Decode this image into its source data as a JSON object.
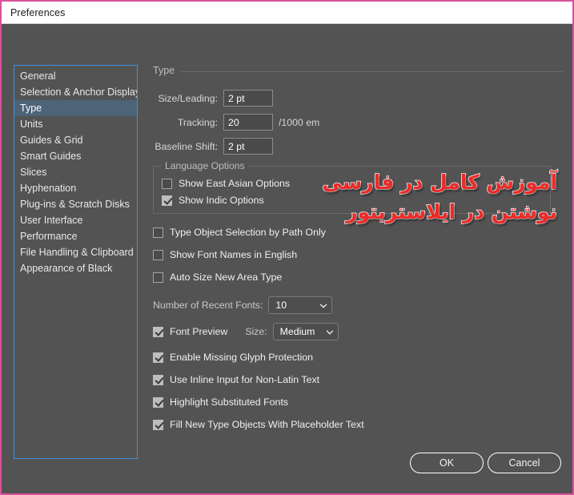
{
  "window": {
    "title": "Preferences",
    "accent_border": "#d9529c",
    "background": "#535353"
  },
  "sidebar": {
    "selected": "Type",
    "items": [
      {
        "label": "General"
      },
      {
        "label": "Selection & Anchor Display"
      },
      {
        "label": "Type"
      },
      {
        "label": "Units"
      },
      {
        "label": "Guides & Grid"
      },
      {
        "label": "Smart Guides"
      },
      {
        "label": "Slices"
      },
      {
        "label": "Hyphenation"
      },
      {
        "label": "Plug-ins & Scratch Disks"
      },
      {
        "label": "User Interface"
      },
      {
        "label": "Performance"
      },
      {
        "label": "File Handling & Clipboard"
      },
      {
        "label": "Appearance of Black"
      }
    ]
  },
  "main": {
    "section_title": "Type",
    "fields": {
      "size_leading": {
        "label": "Size/Leading:",
        "value": "2 pt"
      },
      "tracking": {
        "label": "Tracking:",
        "value": "20",
        "suffix": "/1000 em"
      },
      "baseline_shift": {
        "label": "Baseline Shift:",
        "value": "2 pt"
      }
    },
    "language_options": {
      "title": "Language Options",
      "checkboxes": [
        {
          "label": "Show East Asian Options",
          "checked": false
        },
        {
          "label": "Show Indic Options",
          "checked": true
        }
      ]
    },
    "checkboxes": [
      {
        "label": "Type Object Selection by Path Only",
        "checked": false
      },
      {
        "label": "Show Font Names in English",
        "checked": false
      },
      {
        "label": "Auto Size New Area Type",
        "checked": false
      }
    ],
    "recent_fonts": {
      "label": "Number of Recent Fonts:",
      "value": "10"
    },
    "font_preview": {
      "label": "Font Preview",
      "checked": true,
      "size_label": "Size:",
      "size_value": "Medium"
    },
    "checkboxes_bottom": [
      {
        "label": "Enable Missing Glyph Protection",
        "checked": true
      },
      {
        "label": "Use Inline Input for Non-Latin Text",
        "checked": true
      },
      {
        "label": "Highlight Substituted Fonts",
        "checked": true
      },
      {
        "label": "Fill New Type Objects With Placeholder Text",
        "checked": true
      }
    ]
  },
  "overlay": {
    "color": "#ec2b28",
    "line1": "آموزش کامل در فارسی",
    "line2": "نوشتن در ایلاستریتور"
  },
  "footer": {
    "ok_label": "OK",
    "cancel_label": "Cancel"
  }
}
